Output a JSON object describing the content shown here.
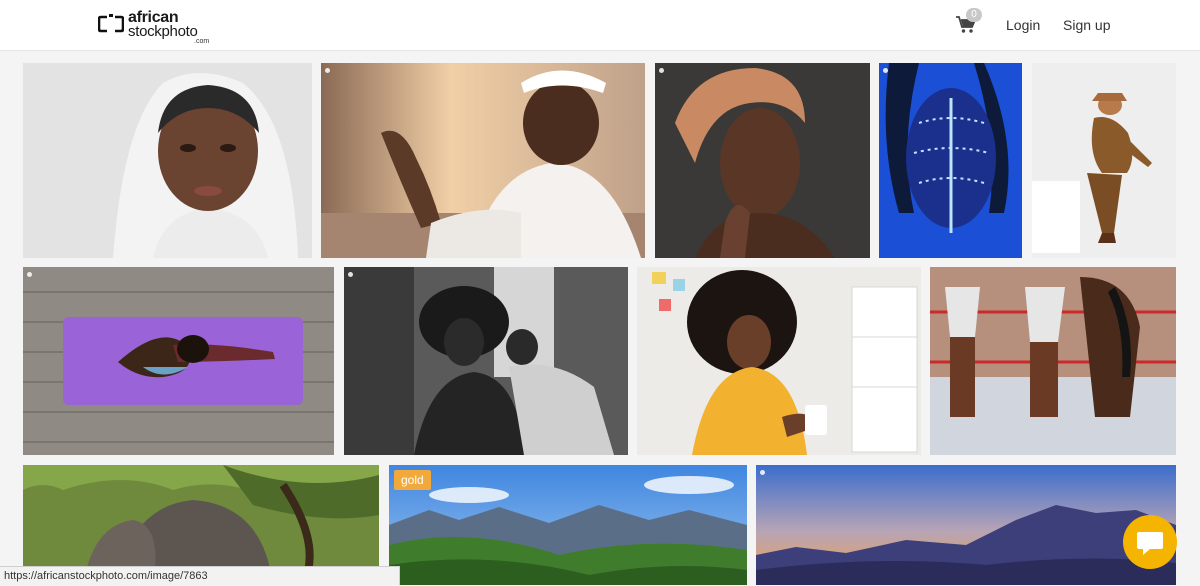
{
  "header": {
    "logo": {
      "line1": "african",
      "line2": "stockphoto",
      "line3": ".com"
    },
    "cart_icon": "cart-icon",
    "cart_count": "0",
    "login_label": "Login",
    "signup_label": "Sign up"
  },
  "gallery": {
    "badge_gold": "gold",
    "tiles": [
      "woman-white-hijab",
      "man-praying-kufi",
      "woman-headwrap-dark",
      "blue-face-paint",
      "man-crouching-hat",
      "yoga-mat-woman",
      "couple-black-white",
      "woman-yellow-mug",
      "dancers-zebra-costumes",
      "elephant-trees",
      "mountains-green-valley",
      "mountains-sunset"
    ]
  },
  "status_bar": {
    "url": "https://africanstockphoto.com/image/7863"
  },
  "chat": {
    "icon": "chat-bubble-icon"
  },
  "colors": {
    "chat_button": "#f4b400",
    "gold_badge": "#f2a93b",
    "header_bg": "#ffffff"
  }
}
